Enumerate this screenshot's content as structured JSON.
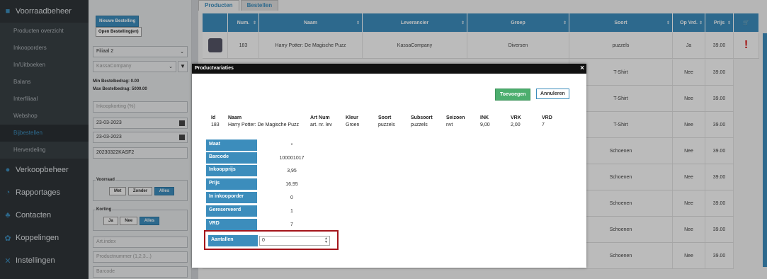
{
  "sidebar": {
    "sections": [
      {
        "label": "Voorraadbeheer",
        "icon": "box-icon"
      },
      {
        "label": "Verkoopbeheer",
        "icon": "shop-icon"
      },
      {
        "label": "Rapportages",
        "icon": "chart-icon"
      },
      {
        "label": "Contacten",
        "icon": "users-icon"
      },
      {
        "label": "Koppelingen",
        "icon": "link-icon"
      },
      {
        "label": "Instellingen",
        "icon": "wrench-icon"
      }
    ],
    "items": [
      {
        "label": "Producten overzicht"
      },
      {
        "label": "Inkooporders"
      },
      {
        "label": "In/Uitboeken"
      },
      {
        "label": "Balans"
      },
      {
        "label": "Interfiliaal"
      },
      {
        "label": "Webshop"
      },
      {
        "label": "Bijbestellen"
      },
      {
        "label": "Herverdeling"
      }
    ]
  },
  "filters": {
    "new_order": "Nieuwe Bestelling",
    "open_order": "Open Bestelling(en)",
    "branch": "Filiaal 2",
    "supplier": "KassaCompany",
    "min_amount": "Min Bestelbedrag: 0.00",
    "max_amount": "Max Bestelbedrag: 5000.00",
    "discount_placeholder": "Inkoopkorting (%)",
    "date1": "23-03-2023",
    "date2": "23-03-2023",
    "order_code": "20230322KASF2",
    "stock_title": "Voorraad",
    "stock_opts": [
      "Met",
      "Zonder",
      "Alles"
    ],
    "discount_title": "Korting",
    "discount_opts": [
      "Ja",
      "Nee",
      "Alles"
    ],
    "artindex_placeholder": "Art.index",
    "productnr_placeholder": "Productnummer (1,2,3...)",
    "barcode_placeholder": "Barcode"
  },
  "tabs": [
    "Producten",
    "Bestellen"
  ],
  "table": {
    "headers": [
      "Num.",
      "Naam",
      "Leverancier",
      "Groep",
      "Soort",
      "Op Vrd.",
      "Prijs"
    ],
    "rows": [
      {
        "num": "183",
        "naam": "Harry Potter: De Magische Puzz",
        "lev": "KassaCompany",
        "groep": "Diversen",
        "soort": "puzzels",
        "opvrd": "Ja",
        "prijs": "39.00",
        "alert": "!"
      },
      {
        "soort": "T-Shirt",
        "opvrd": "Nee",
        "prijs": "39.00"
      },
      {
        "soort": "T-Shirt",
        "opvrd": "Nee",
        "prijs": "39.00"
      },
      {
        "soort": "T-Shirt",
        "opvrd": "Nee",
        "prijs": "39.00"
      },
      {
        "soort": "Schoenen",
        "opvrd": "Nee",
        "prijs": "39.00"
      },
      {
        "soort": "Schoenen",
        "opvrd": "Nee",
        "prijs": "39.00"
      },
      {
        "soort": "Schoenen",
        "opvrd": "Nee",
        "prijs": "39.00"
      },
      {
        "soort": "Schoenen",
        "opvrd": "Nee",
        "prijs": "39.00"
      },
      {
        "soort": "Schoenen",
        "opvrd": "Nee",
        "prijs": "39.00"
      }
    ]
  },
  "modal": {
    "title": "Productvariaties",
    "close": "×",
    "add_btn": "Toevoegen",
    "cancel_btn": "Annuleren",
    "info": [
      {
        "h": "Id",
        "v": "183"
      },
      {
        "h": "Naam",
        "v": "Harry Potter: De Magische Puzz"
      },
      {
        "h": "Art Num",
        "v": "art. nr. lev"
      },
      {
        "h": "Kleur",
        "v": "Groen"
      },
      {
        "h": "Soort",
        "v": "puzzels"
      },
      {
        "h": "Subsoort",
        "v": "puzzels"
      },
      {
        "h": "Seizoen",
        "v": "nvt"
      },
      {
        "h": "INK",
        "v": "9,00"
      },
      {
        "h": "VRK",
        "v": "2,00"
      },
      {
        "h": "VRD",
        "v": "7"
      }
    ],
    "props": [
      {
        "label": "Maat",
        "value": "*"
      },
      {
        "label": "Barcode",
        "value": "100001017"
      },
      {
        "label": "Inkoopprijs",
        "value": "3,95"
      },
      {
        "label": "Prijs",
        "value": "16,95"
      },
      {
        "label": "In inkooporder",
        "value": "0"
      },
      {
        "label": "Gereserveerd",
        "value": "1"
      },
      {
        "label": "VRD",
        "value": "7"
      }
    ],
    "qty_label": "Aantallen",
    "qty_value": "0"
  }
}
